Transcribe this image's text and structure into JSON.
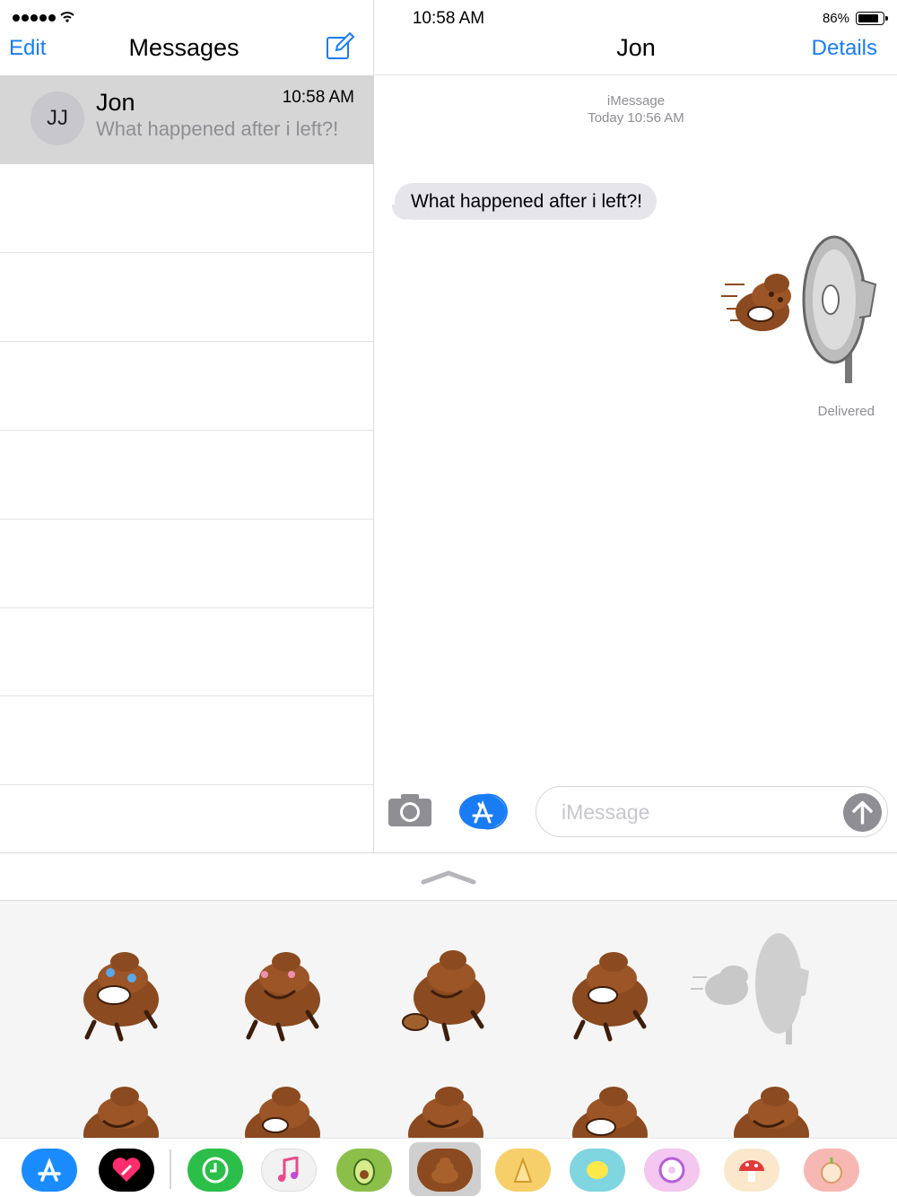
{
  "status_bar": {
    "time": "10:58 AM",
    "battery": "86%",
    "battery_level": 0.86
  },
  "sidebar": {
    "edit_label": "Edit",
    "title": "Messages",
    "conversations": [
      {
        "initials": "JJ",
        "name": "Jon",
        "time": "10:58 AM",
        "preview": "What happened after i left?!"
      }
    ]
  },
  "chat": {
    "contact_name": "Jon",
    "details_label": "Details",
    "service_label": "iMessage",
    "timestamp": "Today 10:56 AM",
    "messages": [
      {
        "direction": "incoming",
        "text": "What happened after i left?!"
      }
    ],
    "delivery_status": "Delivered"
  },
  "composer": {
    "placeholder": "iMessage"
  },
  "colors": {
    "accent": "#1a7cf5",
    "bubble_incoming": "#e5e5ea",
    "poop_brown": "#8b4a1f"
  },
  "sticker_pack": {
    "items": [
      "poop-crying-laughing",
      "poop-blushing",
      "poop-with-little-poop",
      "poop-laughing",
      "poop-fan-blowing",
      "poop-laughing",
      "poop-laughing",
      "poop-laughing",
      "poop-winking",
      "poop-laughing"
    ]
  },
  "app_tray": [
    "app-store-icon",
    "heart-icon",
    "clock-icon",
    "music-icon",
    "avocado-icon",
    "poop-sticker-icon",
    "cheese-icon",
    "lemon-icon",
    "donut-icon",
    "mushroom-icon",
    "onion-icon"
  ]
}
